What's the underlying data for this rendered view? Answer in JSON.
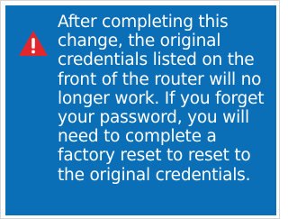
{
  "notice": {
    "icon": "warning-triangle-icon",
    "colors": {
      "panel_background": "#0b6fb8",
      "icon_fill": "#e3262b",
      "text": "#ffffff"
    },
    "message": "After completing this\nchange, the original\ncredentials listed on the\nfront of the router will no\nlonger work. If you forget\nyour password, you will\nneed to complete a\nfactory reset to reset to\nthe original credentials."
  }
}
